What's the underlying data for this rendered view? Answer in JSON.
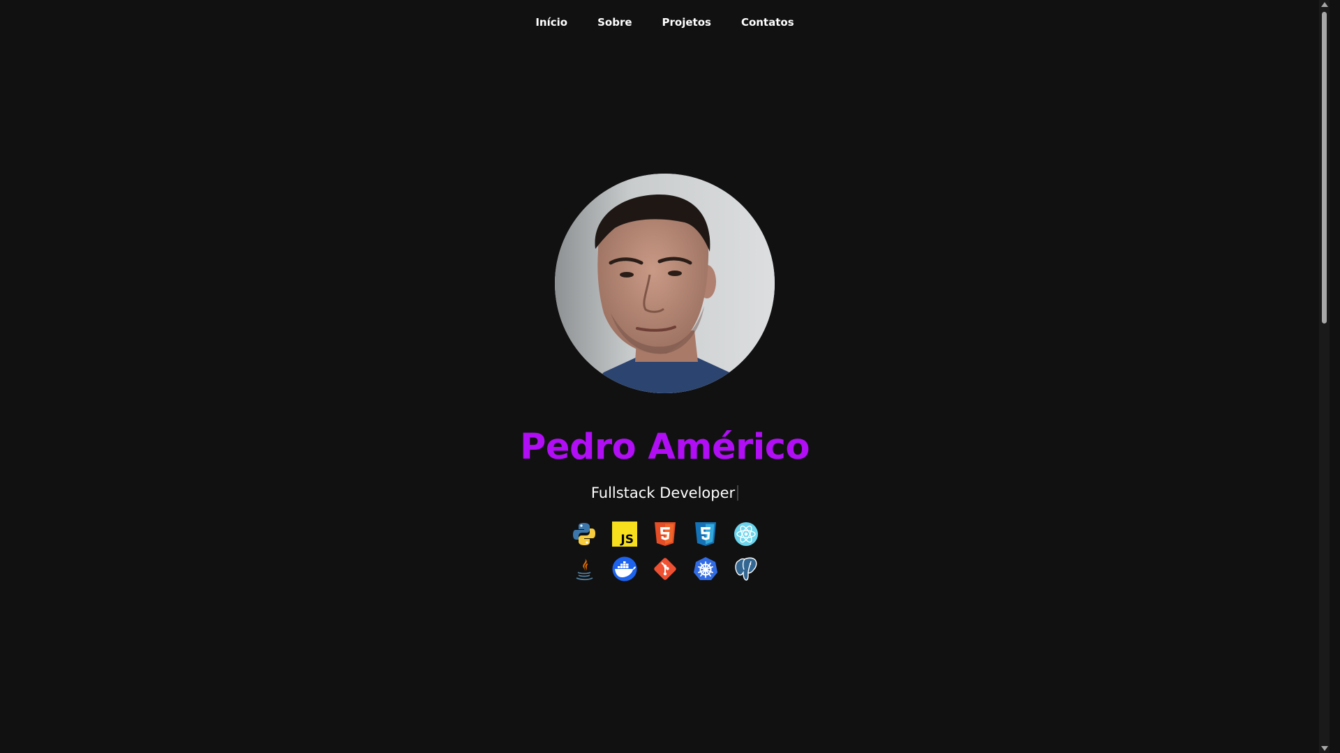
{
  "nav": {
    "items": [
      {
        "label": "Início"
      },
      {
        "label": "Sobre"
      },
      {
        "label": "Projetos"
      },
      {
        "label": "Contatos"
      }
    ]
  },
  "profile": {
    "name": "Pedro Américo",
    "role": "Fullstack Developer",
    "name_color": "#b10ef6"
  },
  "skills": [
    {
      "icon": "python-icon"
    },
    {
      "icon": "javascript-icon"
    },
    {
      "icon": "html5-icon"
    },
    {
      "icon": "css3-icon"
    },
    {
      "icon": "react-icon"
    },
    {
      "icon": "java-icon"
    },
    {
      "icon": "docker-icon"
    },
    {
      "icon": "git-icon"
    },
    {
      "icon": "kubernetes-icon"
    },
    {
      "icon": "postgresql-icon"
    }
  ],
  "colors": {
    "background": "#111112",
    "accent": "#b10ef6"
  }
}
